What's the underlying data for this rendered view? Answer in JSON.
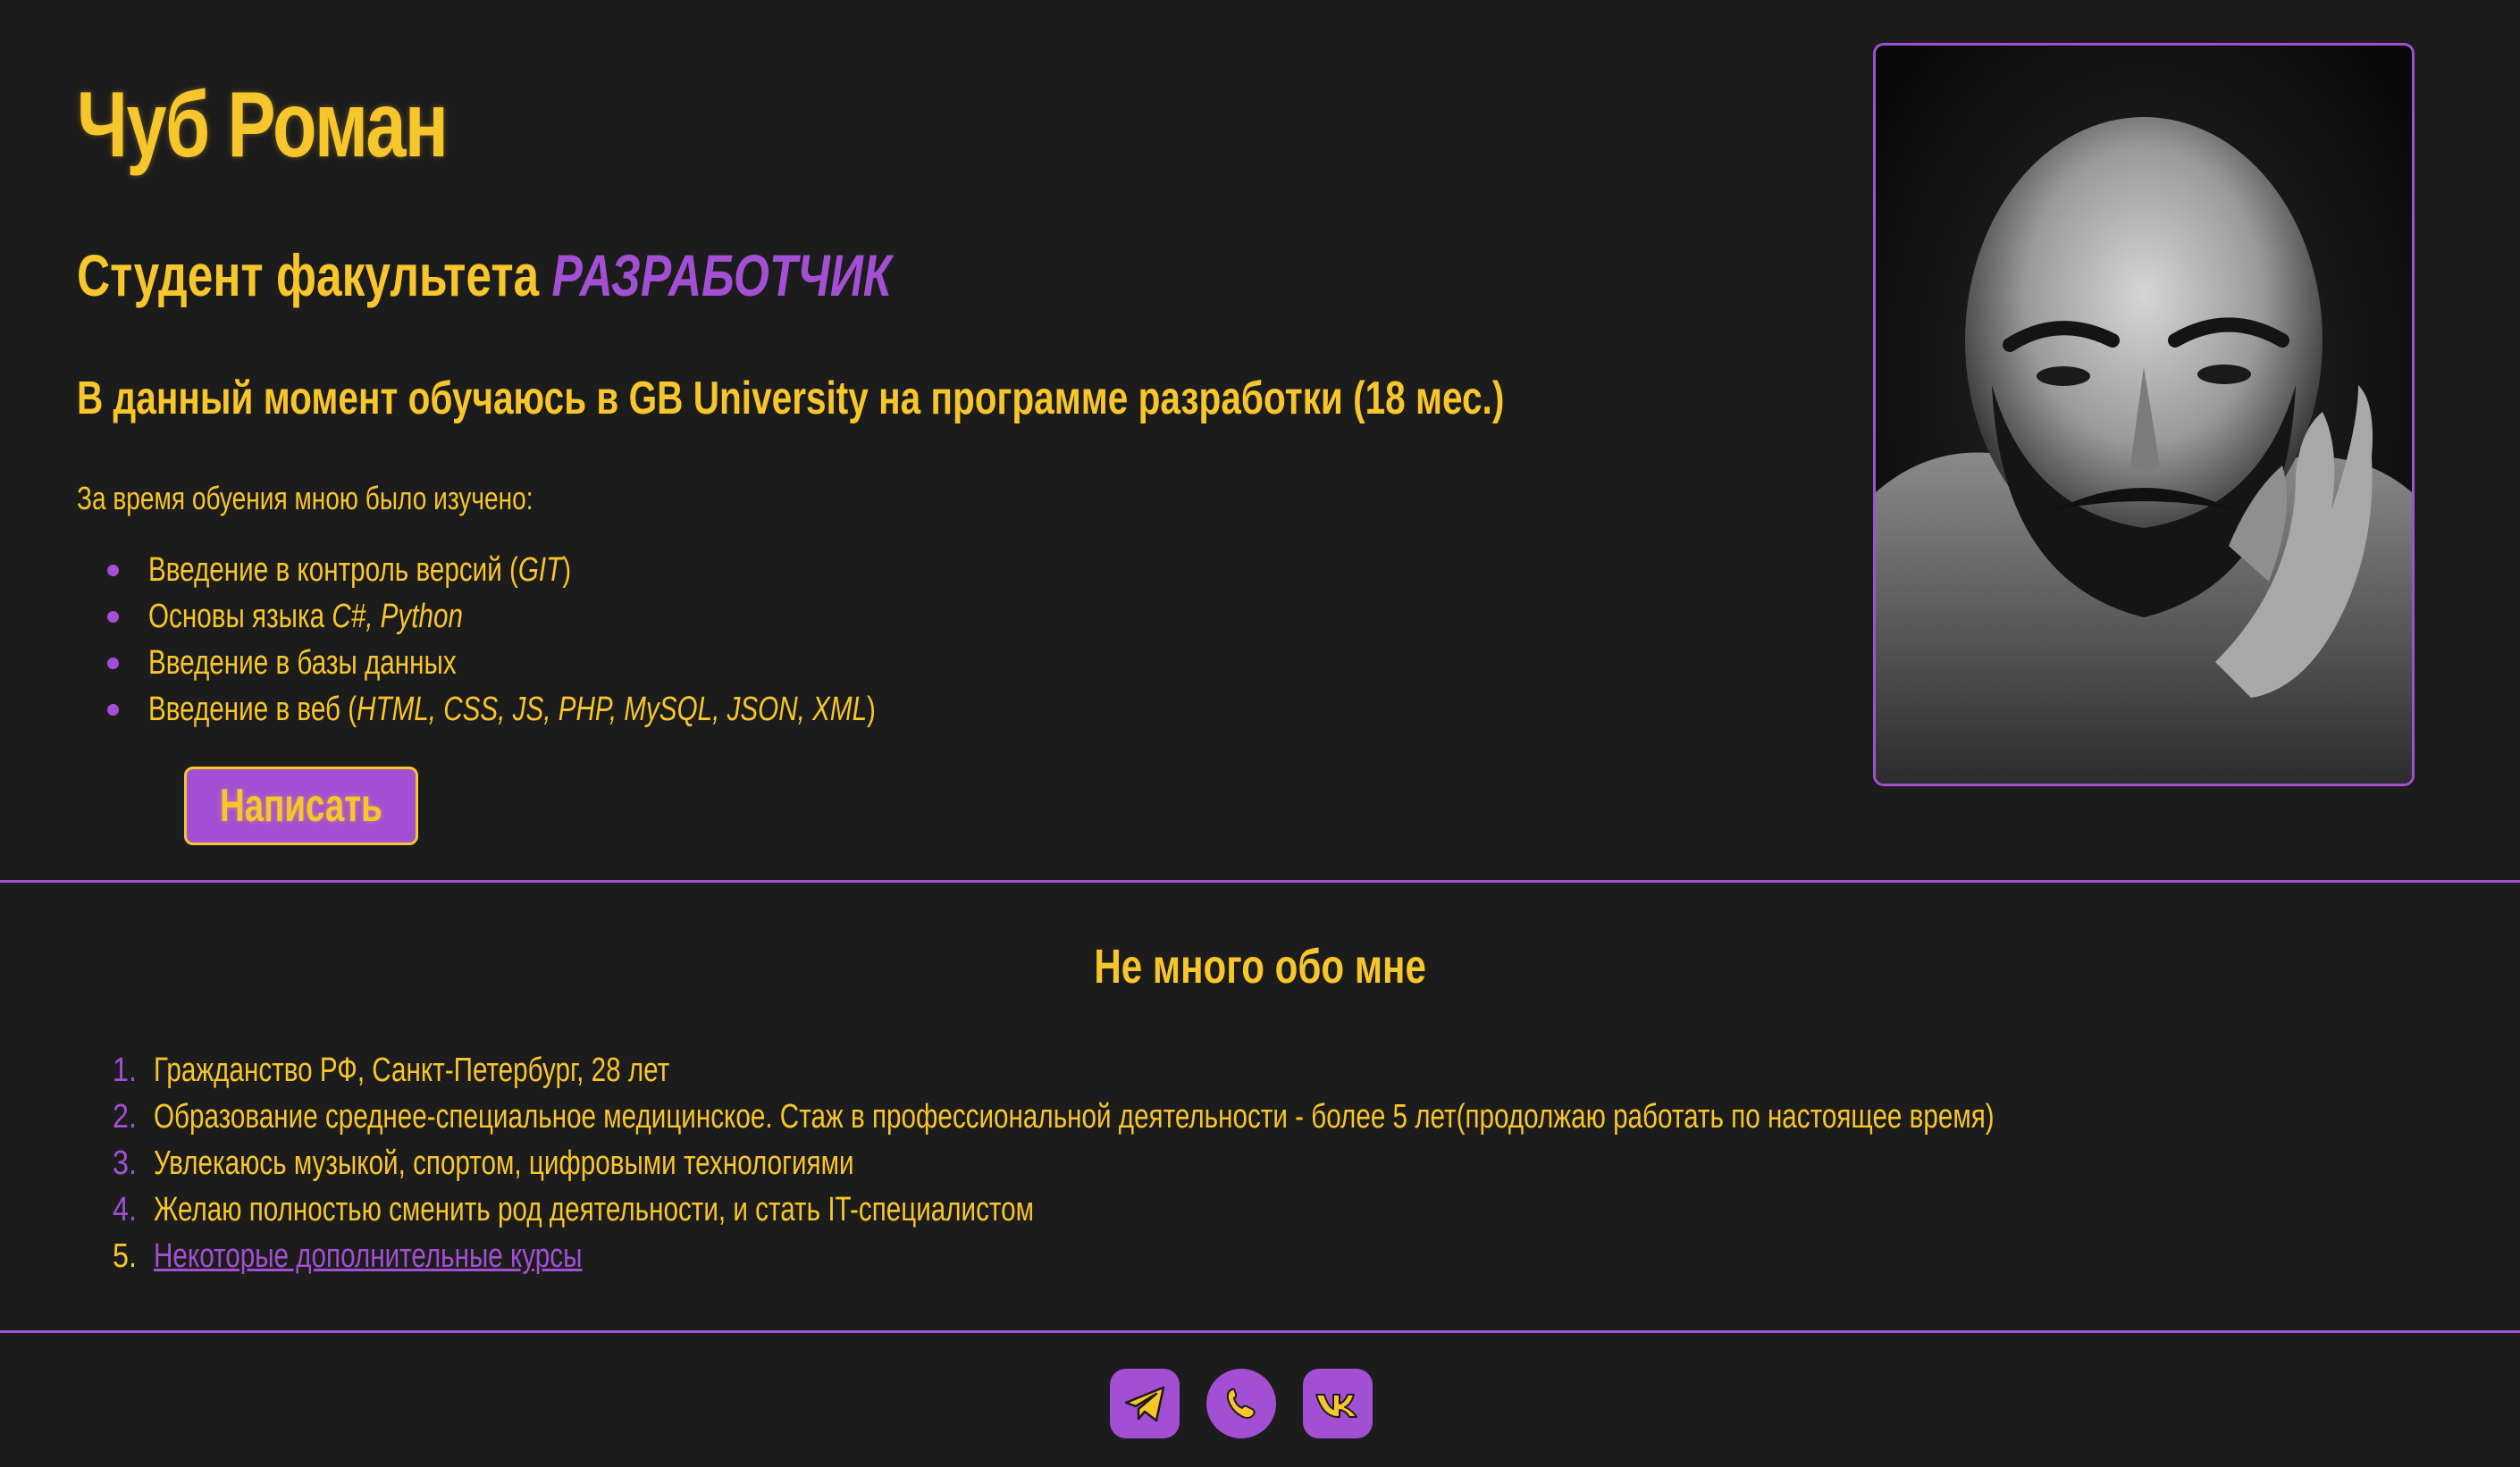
{
  "hero": {
    "name": "Чуб Роман",
    "subtitle_prefix": "Студент факультета",
    "subtitle_role": "РАЗРАБОТЧИК",
    "study": "В данный момент обучаюсь в GB University на программе разработки (18 мес.)",
    "learned_title": "За время обуения мною было изучено:",
    "learned_items": [
      {
        "text": "Введение в контроль версий (",
        "italic": "GIT",
        "after": ")"
      },
      {
        "text": "Основы языка ",
        "italic": "C#, Python",
        "after": ""
      },
      {
        "text": "Введение в базы данных",
        "italic": "",
        "after": ""
      },
      {
        "text": "Введение в веб (",
        "italic": "HTML, CSS, JS, PHP, MySQL, JSON, XML",
        "after": ")"
      }
    ],
    "write_button": "Написать",
    "photo_icon": "portrait-photo"
  },
  "about": {
    "title": "Не много обо мне",
    "items": [
      {
        "num": "1.",
        "text": "Гражданство РФ, Санкт-Петербург, 28 лет"
      },
      {
        "num": "2.",
        "text": "Образование среднее-специальное медицинское. Стаж в профессиональной деятельности - более 5 лет(продолжаю работать по настоящее время)"
      },
      {
        "num": "3.",
        "text": "Увлекаюсь музыкой, спортом, цифровыми технологиями"
      },
      {
        "num": "4.",
        "text": "Желаю полностью сменить род деятельности, и стать IT-специалистом"
      },
      {
        "num": "5.",
        "text": "Некоторые дополнительные курсы"
      }
    ]
  },
  "footer": {
    "socials": [
      "telegram-icon",
      "viber-icon",
      "vk-icon"
    ]
  },
  "colors": {
    "background": "#1c1c1c",
    "accent_yellow": "#f7c52c",
    "accent_purple": "#a34fd3"
  }
}
